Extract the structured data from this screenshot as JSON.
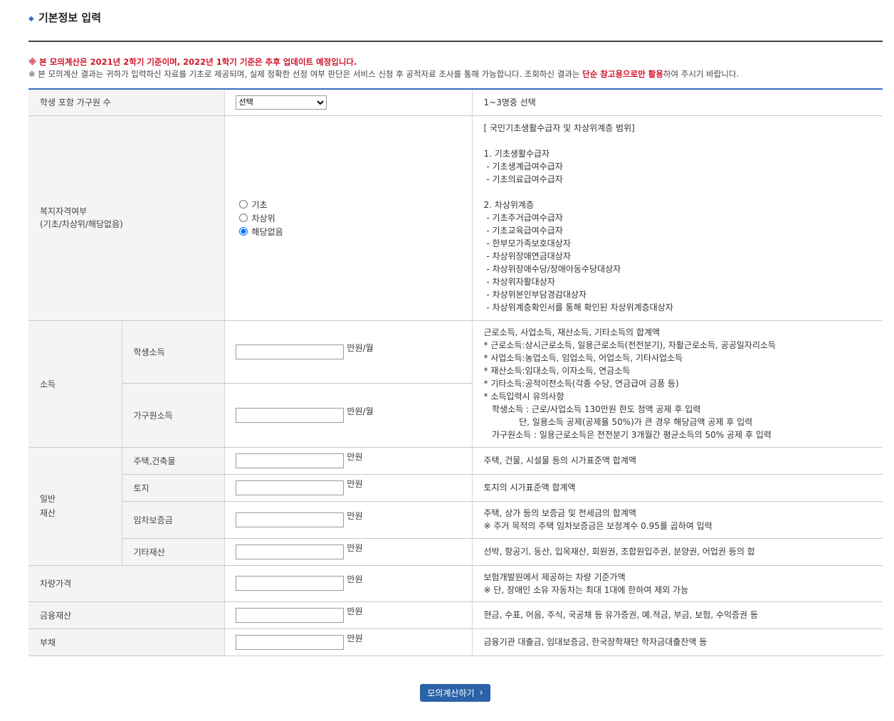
{
  "page": {
    "bullet_icon": "diamond-bullet-icon",
    "title": "기본정보 입력"
  },
  "notices": {
    "line1": "※ 본 모의계산은 2021년 2학기 기준이며, 2022년 1학기 기준은 추후 업데이트 예정입니다.",
    "line2_pre": "※ 본 모의계산 결과는 귀하가 입력하신 자료를 기초로 제공되며, 실제 정확한 선정 여부 판단은 서비스 신청 후 공적자료 조사를 통해 가능합니다. 조회하신 결과는 ",
    "line2_highlight": "단순 참고용으로만 활용",
    "line2_post": "하여 주시기 바랍니다."
  },
  "household": {
    "label": "학생 포함 가구원 수",
    "select_value": "선택",
    "desc": "1~3명중 선택"
  },
  "welfare": {
    "label_line1": "복지자격여부",
    "label_line2": "(기초/차상위/해당없음)",
    "options": [
      "기초",
      "차상위",
      "해당없음"
    ],
    "selected": "해당없음",
    "desc": "[ 국민기초생활수급자 및 차상위계층 범위]\n\n1. 기초생활수급자\n - 기초생계급여수급자\n - 기초의료급여수급자\n\n2. 차상위계층\n - 기초주거급여수급자\n - 기초교육급여수급자\n - 한부모가족보호대상자\n - 차상위장애연금대상자\n - 차상위장애수당/장애아동수당대상자\n - 차상위자활대상자\n - 차상위본인부담경감대상자\n - 차상위계층확인서를 통해 확인된 차상위계층대상자"
  },
  "income": {
    "group_label": "소득",
    "student_label": "학생소득",
    "household_label": "가구원소득",
    "student_value": "",
    "household_value": "",
    "unit": "만원/월",
    "desc": "근로소득, 사업소득, 재산소득, 기타소득의 합계액\n* 근로소득:상시근로소득, 일용근로소득(전전분기), 자활근로소득, 공공일자리소득\n* 사업소득:농업소득, 임업소득, 어업소득, 기타사업소득\n* 재산소득:임대소득, 이자소득, 연금소득\n* 기타소득:공적이전소득(각종 수당, 연금급여 금품 등)\n* 소득입력시 유의사항\n   학생소득 : 근로/사업소득 130만원 한도 정액 공제 후 입력\n             단, 일용소득 공제(공제율 50%)가 큰 경우 해당금액 공제 후 입력\n   가구원소득 : 일용근로소득은 전전분기 3개월간 평균소득의 50% 공제 후 입력"
  },
  "assets": {
    "group_label_line1": "일반",
    "group_label_line2": "재산",
    "unit": "만원",
    "rows": [
      {
        "label": "주택,건축물",
        "value": "",
        "desc": "주택, 건물, 시설물 등의 시가표준액 합계액"
      },
      {
        "label": "토지",
        "value": "",
        "desc": "토지의 시가표준액 합계액"
      },
      {
        "label": "임차보증금",
        "value": "",
        "desc": "주택, 상가 등의 보증금 및 전세금의 합계액\n※ 주거 목적의 주택 임차보증금은 보정계수 0.95를 곱하여 입력"
      },
      {
        "label": "기타재산",
        "value": "",
        "desc": "선박, 항공기, 동산, 입목재산, 회원권, 조합원입주권, 분양권, 어업권 등의 합"
      }
    ]
  },
  "vehicle": {
    "label": "차량가격",
    "value": "",
    "unit": "만원",
    "desc": "보험개발원에서 제공하는 차량 기준가액\n※ 단, 장애인 소유 자동차는 최대 1대에 한하여 제외 가능"
  },
  "financial": {
    "label": "금융재산",
    "value": "",
    "unit": "만원",
    "desc": "현금, 수표, 어음, 주식, 국공채 등 유가증권, 예.적금, 부금, 보험, 수익증권 등"
  },
  "debt": {
    "label": "부채",
    "value": "",
    "unit": "만원",
    "desc": "금융기관 대출금, 임대보증금, 한국장학재단 학자금대출잔액 등"
  },
  "submit": {
    "label": "모의계산하기",
    "icon": "chevron-right-icon"
  }
}
